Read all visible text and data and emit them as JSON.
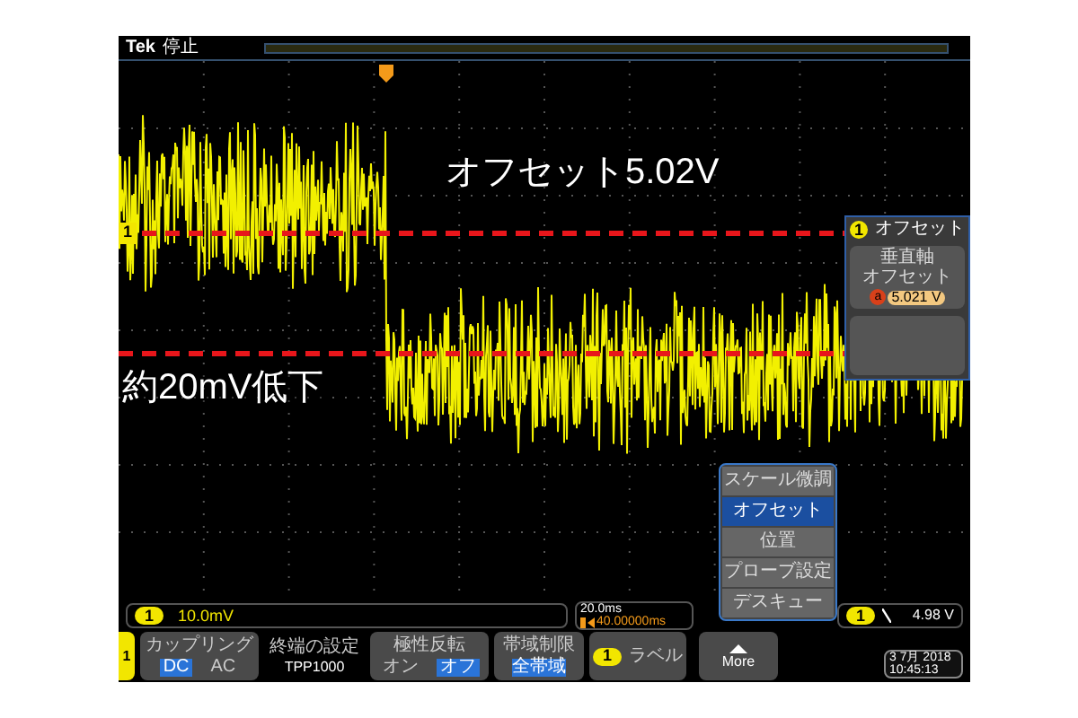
{
  "top_bar": {
    "brand": "Tek",
    "state": "停止"
  },
  "annotations": [
    {
      "text": "オフセット5.02V"
    },
    {
      "text": "約20mV低下"
    }
  ],
  "channel_marker": "1",
  "offset_panel": {
    "channel": "1",
    "title": "オフセット",
    "button": {
      "label_lines": [
        "垂直軸",
        "オフセット"
      ],
      "knob": "a",
      "value": "5.021 V"
    }
  },
  "menu": {
    "items": [
      {
        "label": "スケール微調",
        "selected": false
      },
      {
        "label": "オフセット",
        "selected": true
      },
      {
        "label": "位置",
        "selected": false
      },
      {
        "label": "プローブ設定",
        "selected": false
      },
      {
        "label": "デスキュー",
        "selected": false
      }
    ]
  },
  "readouts": {
    "channel_scale": {
      "channel": "1",
      "value": "10.0mV"
    },
    "timebase": {
      "scale": "20.0ms",
      "position": "40.00000ms"
    },
    "trigger": {
      "channel": "1",
      "level": "4.98 V"
    }
  },
  "softkeys": {
    "channel_tab": "1",
    "items": [
      {
        "kind": "toggle",
        "title": "カップリング",
        "options": [
          {
            "label": "DC",
            "selected": true
          },
          {
            "label": "AC",
            "selected": false
          }
        ]
      },
      {
        "kind": "info",
        "title": "終端の設定",
        "value": "TPP1000"
      },
      {
        "kind": "toggle",
        "title": "極性反転",
        "options": [
          {
            "label": "オン",
            "selected": false
          },
          {
            "label": "オフ",
            "selected": true
          }
        ]
      },
      {
        "kind": "value",
        "title": "帯域制限",
        "value": "全帯域"
      },
      {
        "kind": "label",
        "channel": "1",
        "title": "ラベル"
      },
      {
        "kind": "more",
        "title": "More"
      }
    ]
  },
  "clock": {
    "date": "3 7月 2018",
    "time": "10:45:13"
  }
}
